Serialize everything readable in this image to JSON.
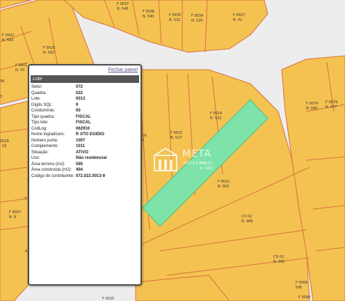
{
  "map": {
    "colors": {
      "plot": "#f4c251",
      "border": "#d8703f",
      "selected": "#7de3a8",
      "selected_border": "#57c58b",
      "road": "#ededed"
    },
    "plot_labels": [
      {
        "code": "F 0037",
        "num": "N. 540"
      },
      {
        "code": "F 0036",
        "num": "N. 540"
      },
      {
        "code": "F 0035",
        "num": "N. 532"
      },
      {
        "code": "F 0034",
        "num": "N. 520"
      },
      {
        "code": "F 0027",
        "num": "N. 41"
      },
      {
        "code": "F 0002",
        "num": "N. 583"
      },
      {
        "code": "F 0025",
        "num": "N. 563"
      },
      {
        "code": "F 0001",
        "num": "N. 33"
      },
      {
        "code": "F 0079",
        "num": "N. 477"
      },
      {
        "code": "F 0074",
        "num": "N. 090"
      },
      {
        "code": "F 0014",
        "num": "N. 515"
      },
      {
        "code": "F 0015",
        "num": "N. 527"
      },
      {
        "code": "F 0012",
        "num": "N. 993"
      },
      {
        "code": "CD 02",
        "num": "N. 989"
      },
      {
        "code": "CD 01",
        "num": "N. 991"
      },
      {
        "code": "F 0007",
        "num": "N. 9"
      },
      {
        "code": "F 0008",
        "num": "S/N"
      }
    ],
    "label_fragments": [
      "36",
      "0019",
      "19",
      "2",
      "4",
      "016",
      "25",
      "F 0025",
      "F 0090",
      "3",
      "5"
    ],
    "selected_label": {
      "code": "F 0013",
      "num": "N. 1007"
    }
  },
  "watermark": {
    "brand": "META",
    "sub": "IMÓVEIS"
  },
  "panel": {
    "close_label": "Fechar painel",
    "header": "Lote",
    "attributes": [
      {
        "label": "Setor:",
        "value": "072"
      },
      {
        "label": "Quadra:",
        "value": "022"
      },
      {
        "label": "Lote:",
        "value": "0013"
      },
      {
        "label": "Dígito SQL:",
        "value": "9"
      },
      {
        "label": "Condomínio:",
        "value": "00"
      },
      {
        "label": "Tipo quadra:",
        "value": "FISCAL"
      },
      {
        "label": "Tipo lote:",
        "value": "FISCAL"
      },
      {
        "label": "CodLog:",
        "value": "062910"
      },
      {
        "label": "Nome logradouro:",
        "value": "R STO EGIDIO"
      },
      {
        "label": "Número porta:",
        "value": "1007"
      },
      {
        "label": "Complemento:",
        "value": "1011"
      },
      {
        "label": "Situação:",
        "value": "ATIVO"
      },
      {
        "label": "Uso:",
        "value": "Não residencial"
      },
      {
        "label": "Área terreno (m2):",
        "value": "595"
      },
      {
        "label": "Área construída (m2):",
        "value": "404"
      },
      {
        "label": "Código do contribuinte:",
        "value": "072.022.0013-9"
      }
    ]
  }
}
